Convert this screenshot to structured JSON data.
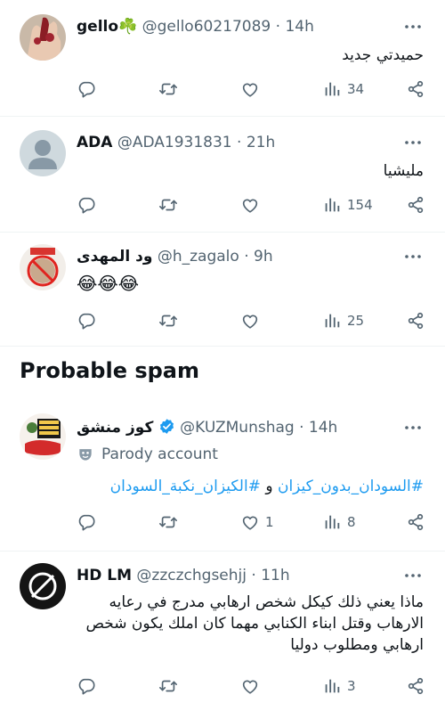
{
  "tweets": [
    {
      "name": "gello☘️",
      "handle": "@gello60217089",
      "time": "14h",
      "text": "حميدتي جديد",
      "views": "34"
    },
    {
      "name": "ADA",
      "handle": "@ADA1931831",
      "time": "21h",
      "text": "مليشيا",
      "views": "154"
    },
    {
      "name": "ود المهدى",
      "handle": "@h_zagalo",
      "time": "9h",
      "text": "😂😂😂",
      "views": "25"
    }
  ],
  "section": {
    "title": "Probable spam"
  },
  "spam_tweets": [
    {
      "name": "كوز منشق",
      "handle": "@KUZMunshag",
      "time": "14h",
      "parody_label": "Parody account",
      "hashtag1": "#السودان_بدون_كيزان",
      "conj": "و",
      "hashtag2": "#الكيزان_نكبة_السودان",
      "likes": "1",
      "views": "8"
    },
    {
      "name": "HD LM",
      "handle": "@zzczchgsehjj",
      "time": "11h",
      "text_line1": "ماذا يعني ذلك كيكل شخص ارهابي مدرج في رعايه",
      "text_line2": "الارهاب وقتل ابناء الكنابي مهما كان املك يكون شخص",
      "text_line3": "ارهابي ومطلوب دوليا",
      "views": "3"
    }
  ],
  "colors": {
    "link": "#1d9bf0",
    "muted": "#536471",
    "text": "#0f1419",
    "divider": "#eff3f4"
  }
}
